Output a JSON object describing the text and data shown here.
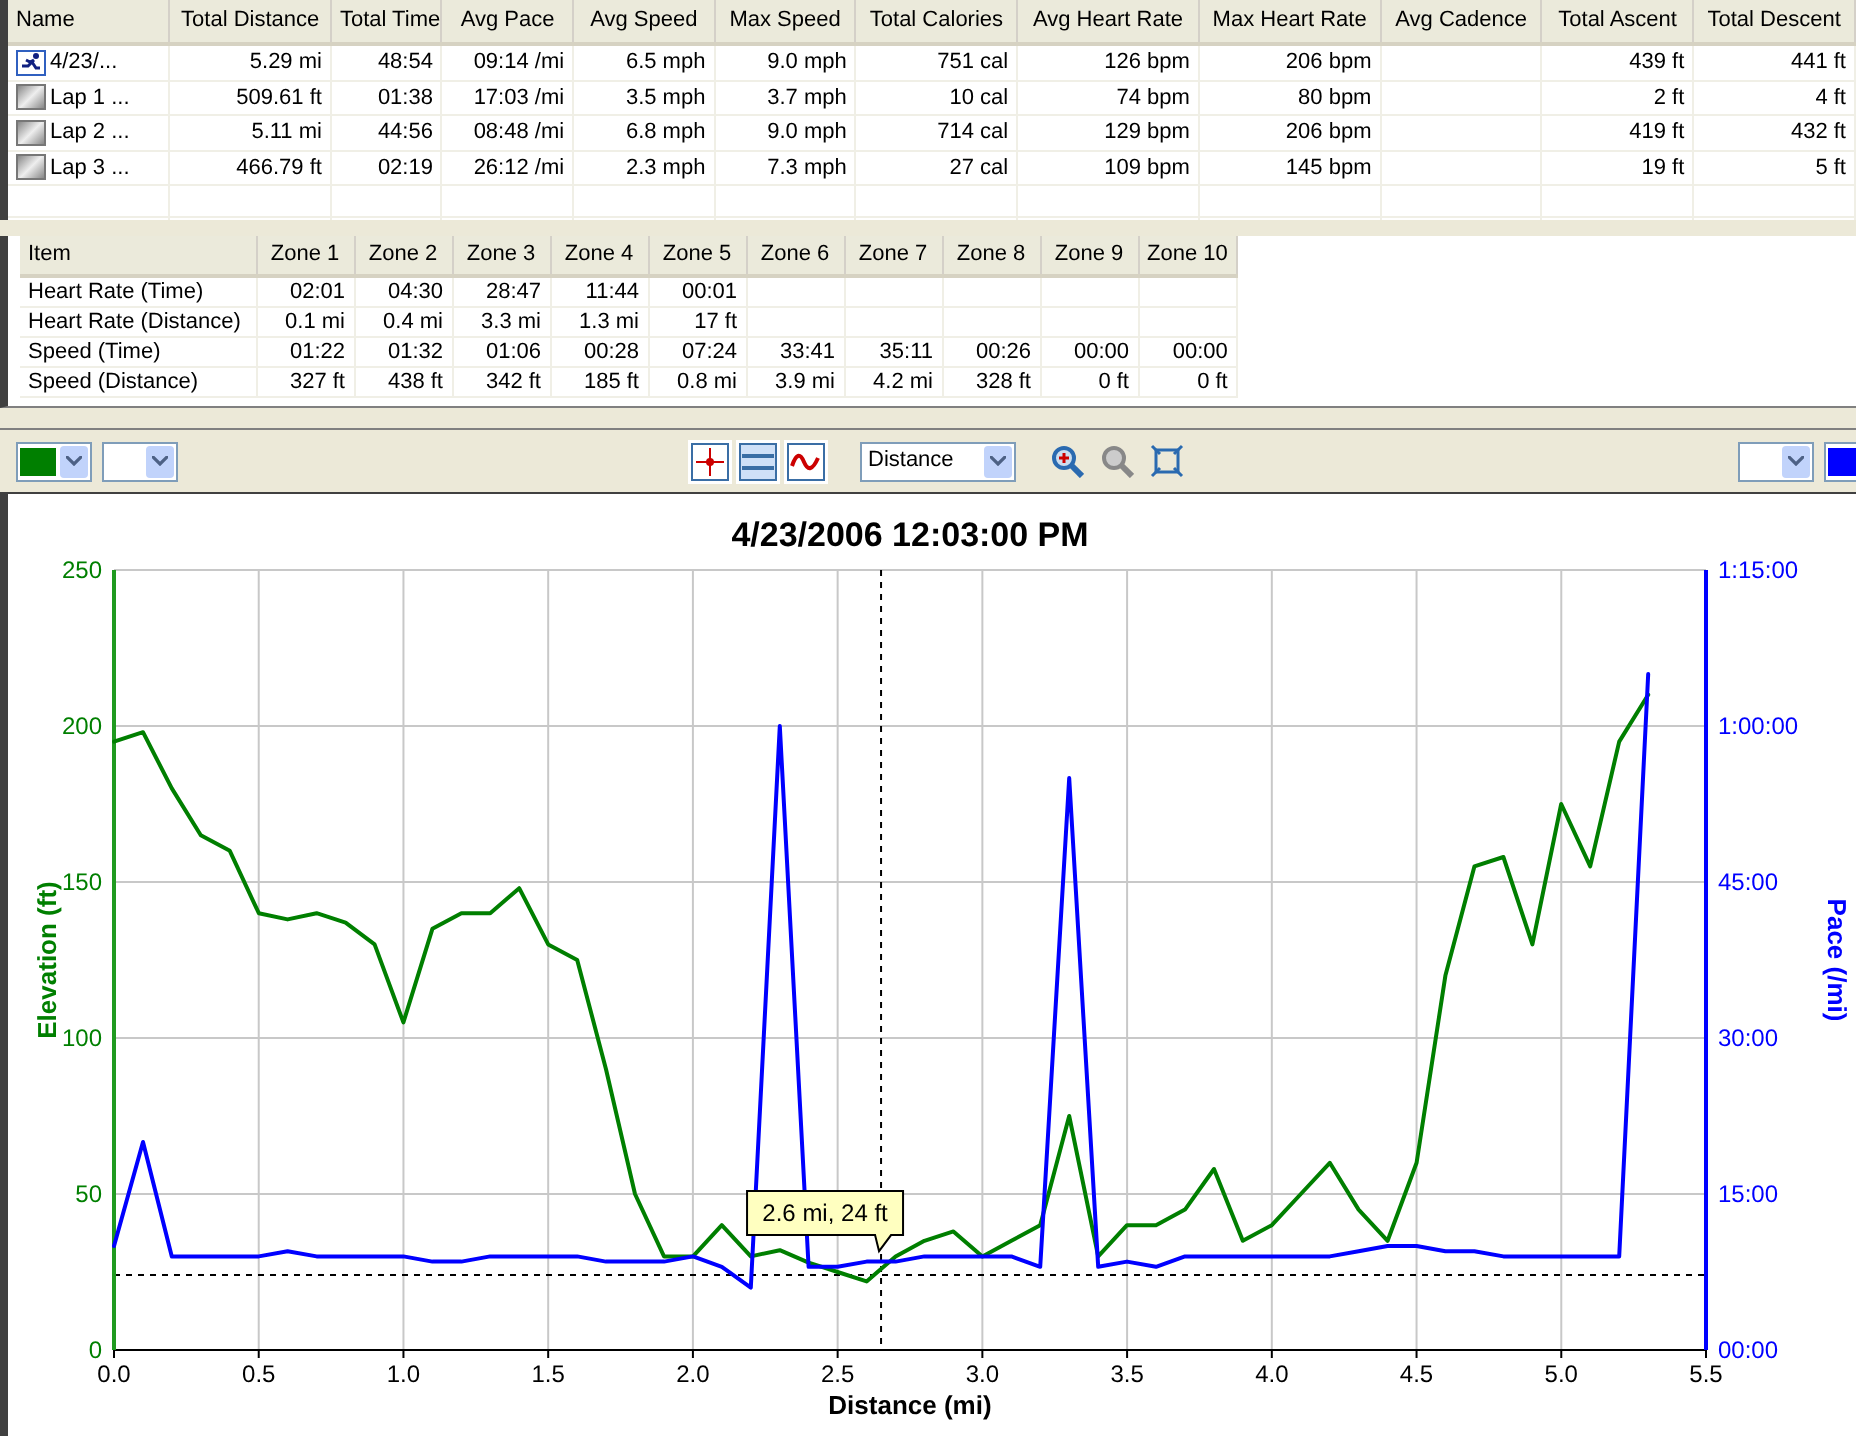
{
  "laps_table": {
    "columns": [
      "Name",
      "Total Distance",
      "Total Time",
      "Avg Pace",
      "Avg Speed",
      "Max Speed",
      "Total Calories",
      "Avg Heart Rate",
      "Max Heart Rate",
      "Avg Cadence",
      "Total Ascent",
      "Total Descent"
    ],
    "rows": [
      {
        "kind": "activity",
        "cells": [
          "4/23/...",
          "5.29 mi",
          "48:54",
          "09:14 /mi",
          "6.5 mph",
          "9.0 mph",
          "751 cal",
          "126 bpm",
          "206 bpm",
          "",
          "439 ft",
          "441 ft"
        ]
      },
      {
        "kind": "lap",
        "cells": [
          "Lap 1 ...",
          "509.61 ft",
          "01:38",
          "17:03 /mi",
          "3.5 mph",
          "3.7 mph",
          "10 cal",
          "74 bpm",
          "80 bpm",
          "",
          "2 ft",
          "4 ft"
        ]
      },
      {
        "kind": "lap",
        "cells": [
          "Lap 2 ...",
          "5.11 mi",
          "44:56",
          "08:48 /mi",
          "6.8 mph",
          "9.0 mph",
          "714 cal",
          "129 bpm",
          "206 bpm",
          "",
          "419 ft",
          "432 ft"
        ]
      },
      {
        "kind": "lap",
        "cells": [
          "Lap 3 ...",
          "466.79 ft",
          "02:19",
          "26:12 /mi",
          "2.3 mph",
          "7.3 mph",
          "27 cal",
          "109 bpm",
          "145 bpm",
          "",
          "19 ft",
          "5 ft"
        ]
      }
    ]
  },
  "zones_table": {
    "columns": [
      "Item",
      "Zone 1",
      "Zone 2",
      "Zone 3",
      "Zone 4",
      "Zone 5",
      "Zone 6",
      "Zone 7",
      "Zone 8",
      "Zone 9",
      "Zone 10"
    ],
    "rows": [
      [
        "Heart Rate (Time)",
        "02:01",
        "04:30",
        "28:47",
        "11:44",
        "00:01"
      ],
      [
        "Heart Rate (Distance)",
        "0.1 mi",
        "0.4 mi",
        "3.3 mi",
        "1.3 mi",
        "17 ft"
      ],
      [
        "Speed (Time)",
        "01:22",
        "01:32",
        "01:06",
        "00:28",
        "07:24",
        "33:41",
        "35:11",
        "00:26",
        "00:00",
        "00:00"
      ],
      [
        "Speed (Distance)",
        "327 ft",
        "438 ft",
        "342 ft",
        "185 ft",
        "0.8 mi",
        "3.9 mi",
        "4.2 mi",
        "328 ft",
        "0 ft",
        "0 ft"
      ]
    ]
  },
  "toolbar": {
    "left_color": {
      "color": "#007f00"
    },
    "x_axis_select": {
      "value": "Distance"
    },
    "right_color": {
      "color": "#0000ff"
    }
  },
  "chart": {
    "chart_data": {
      "type": "line",
      "title": "4/23/2006 12:03:00 PM",
      "xlabel": "Distance (mi)",
      "ylabel": "Elevation (ft)",
      "y2label": "Pace (/mi)",
      "x": [
        0.0,
        0.1,
        0.2,
        0.3,
        0.4,
        0.5,
        0.6,
        0.7,
        0.8,
        0.9,
        1.0,
        1.1,
        1.2,
        1.3,
        1.4,
        1.5,
        1.6,
        1.7,
        1.8,
        1.9,
        2.0,
        2.1,
        2.2,
        2.3,
        2.4,
        2.5,
        2.6,
        2.7,
        2.8,
        2.9,
        3.0,
        3.1,
        3.2,
        3.3,
        3.4,
        3.5,
        3.6,
        3.7,
        3.8,
        3.9,
        4.0,
        4.1,
        4.2,
        4.3,
        4.4,
        4.5,
        4.6,
        4.7,
        4.8,
        4.9,
        5.0,
        5.1,
        5.2,
        5.3
      ],
      "series": [
        {
          "color": "#007f00",
          "values": [
            195,
            198,
            180,
            165,
            160,
            140,
            138,
            140,
            137,
            130,
            105,
            135,
            140,
            140,
            148,
            130,
            125,
            90,
            50,
            30,
            30,
            40,
            30,
            32,
            28,
            25,
            22,
            30,
            35,
            38,
            30,
            35,
            40,
            75,
            30,
            40,
            40,
            45,
            58,
            35,
            40,
            50,
            60,
            45,
            35,
            60,
            120,
            155,
            158,
            130,
            175,
            155,
            195,
            210
          ]
        },
        {
          "color": "#0000ff",
          "axis": "y2",
          "values": [
            10,
            20,
            9,
            9,
            9,
            9,
            9.5,
            9,
            9,
            9,
            9,
            8.5,
            8.5,
            9,
            9,
            9,
            9,
            8.5,
            8.5,
            8.5,
            9,
            8,
            6,
            60,
            8,
            8,
            8.5,
            8.5,
            9,
            9,
            9,
            9,
            8,
            55,
            8,
            8.5,
            8,
            9,
            9,
            9,
            9,
            9,
            9,
            9.5,
            10,
            10,
            9.5,
            9.5,
            9,
            9,
            9,
            9,
            9,
            65
          ]
        }
      ],
      "xlim": [
        0,
        5.5
      ],
      "ylim": [
        0,
        250
      ],
      "y2lim": [
        0,
        75
      ],
      "xticks": [
        {
          "value": 0,
          "label": "0.0"
        },
        0.5,
        {
          "value": 1,
          "label": "1.0"
        },
        1.5,
        {
          "value": 2,
          "label": "2.0"
        },
        2.5,
        {
          "value": 3,
          "label": "3.0"
        },
        3.5,
        {
          "value": 4,
          "label": "4.0"
        },
        4.5,
        {
          "value": 5,
          "label": "5.0"
        },
        5.5
      ],
      "yticks": [
        0,
        50,
        100,
        150,
        200,
        250
      ],
      "y2ticks": [
        {
          "value": 0,
          "label": "00:00"
        },
        {
          "value": 15,
          "label": "15:00"
        },
        {
          "value": 30,
          "label": "30:00"
        },
        {
          "value": 45,
          "label": "45:00"
        },
        {
          "value": 60,
          "label": "1:00:00"
        },
        {
          "value": 75,
          "label": "1:15:00"
        }
      ],
      "grid": true,
      "ref_lines": [
        {
          "axis": "x",
          "value": 2.65
        },
        {
          "axis": "y",
          "value": 24
        }
      ],
      "annotations": [
        {
          "text": "2.6 mi, 24 ft",
          "x": 2.65,
          "y": 24
        }
      ]
    }
  }
}
